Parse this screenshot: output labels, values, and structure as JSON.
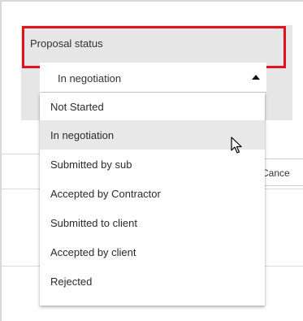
{
  "field": {
    "label": "Proposal status",
    "selected_value": "In negotiation"
  },
  "dropdown": {
    "options": [
      "Not Started",
      "In negotiation",
      "Submitted by sub",
      "Accepted by Contractor",
      "Submitted to client",
      "Accepted by client",
      "Rejected"
    ],
    "selected_index": 1
  },
  "background": {
    "cancel_label": "Cance"
  },
  "colors": {
    "highlight": "#e0121b",
    "panel": "#e6e6e6",
    "selected_option": "#e8e8e8"
  },
  "icons": {
    "caret": "caret-up-icon",
    "cursor": "cursor-arrow-icon"
  }
}
